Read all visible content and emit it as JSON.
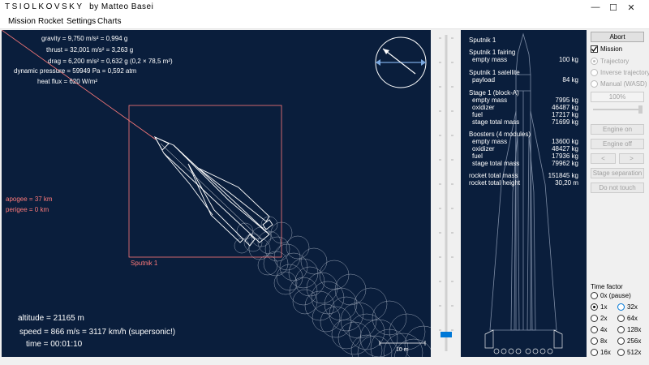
{
  "window": {
    "title_brand": "TSIOLKOVSKY",
    "title_by": "by Matteo Basei",
    "minimize_glyph": "—",
    "maximize_glyph": "☐",
    "close_glyph": "✕"
  },
  "menu": [
    "Mission",
    "Rocket",
    "Settings",
    "Charts"
  ],
  "telemetry": {
    "gravity": "gravity = 9,750 m/s² = 0,994 g",
    "thrust": "thrust = 32,001 m/s² = 3,263 g",
    "drag": "drag = 6,200 m/s² = 0,632 g (0,2 × 78,5 m²)",
    "dynamic_pressure": "dynamic pressure = 59949 Pa = 0,592 atm",
    "heat_flux": "heat flux = 620 W/m²",
    "apogee": "apogee = 37 km",
    "perigee": "perigee = 0 km",
    "altitude": "altitude = 21165 m",
    "speed": "speed = 866 m/s = 3117 km/h (supersonic!)",
    "time": "time = 00:01:10"
  },
  "view": {
    "target_label": "Sputnik 1",
    "scale_label": "10 m"
  },
  "rocket": {
    "name": "Sputnik 1",
    "sections": [
      {
        "header": "Sputnik 1 fairing",
        "rows": [
          {
            "k": "empty mass",
            "v": "100 kg"
          }
        ]
      },
      {
        "header": "Sputnik 1 satellite",
        "rows": [
          {
            "k": "payload",
            "v": "84 kg"
          }
        ]
      },
      {
        "header": "Stage 1 (block-A)",
        "rows": [
          {
            "k": "empty mass",
            "v": "7995 kg"
          },
          {
            "k": "oxidizer",
            "v": "46487 kg"
          },
          {
            "k": "fuel",
            "v": "17217 kg"
          },
          {
            "k": "stage total mass",
            "v": "71699 kg"
          }
        ]
      },
      {
        "header": "Boosters (4 modules)",
        "rows": [
          {
            "k": "empty mass",
            "v": "13600 kg"
          },
          {
            "k": "oxidizer",
            "v": "48427 kg"
          },
          {
            "k": "fuel",
            "v": "17936 kg"
          },
          {
            "k": "stage total mass",
            "v": "79962 kg"
          }
        ]
      }
    ],
    "total_mass_label": "rocket total mass",
    "total_mass": "151845 kg",
    "total_height_label": "rocket total height",
    "total_height": "30,20 m"
  },
  "controls": {
    "abort": "Abort",
    "mission": "Mission",
    "trajectory": "Trajectory",
    "inverse_trajectory": "Inverse trajectory",
    "manual": "Manual (WASD)",
    "throttle": "100%",
    "engine_on": "Engine on",
    "engine_off": "Engine off",
    "prev": "<",
    "next": ">",
    "stage_separation": "Stage separation",
    "do_not_touch": "Do not touch",
    "time_factor_label": "Time factor",
    "time_factors": [
      "0x (pause)",
      "1x",
      "32x",
      "2x",
      "64x",
      "4x",
      "128x",
      "8x",
      "256x",
      "16x",
      "512x"
    ],
    "selected_time_factor": "1x"
  },
  "colors": {
    "sky": "#0a1e3c",
    "orbit": "#ff7a7a",
    "accent": "#0078d7"
  }
}
